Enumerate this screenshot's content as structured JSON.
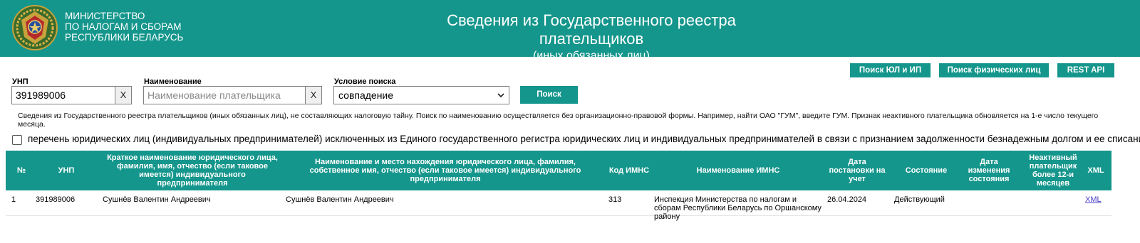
{
  "header": {
    "ministry_line1": "МИНИСТЕРСТВО",
    "ministry_line2": "ПО НАЛОГАМ И СБОРАМ",
    "ministry_line3": "РЕСПУБЛИКИ БЕЛАРУСЬ",
    "title": "Сведения из Государственного реестра плательщиков",
    "subtitle": "(иных обязанных лиц)"
  },
  "nav_buttons": {
    "search_legal": "Поиск ЮЛ и ИП",
    "search_individuals": "Поиск физических лиц",
    "rest_api": "REST API"
  },
  "search": {
    "unp_label": "УНП",
    "unp_value": "391989006",
    "name_label": "Наименование",
    "name_placeholder": "Наименование плательщика",
    "condition_label": "Условие поиска",
    "condition_value": "совпадение",
    "clear_label": "X",
    "search_button": "Поиск"
  },
  "info_text": "Сведения из Государственного реестра плательщиков (иных обязанных лиц), не составляющих налоговую тайну. Поиск по наименованию осуществляется без организационно-правовой формы. Например, найти ОАО \"ГУМ\", введите ГУМ. Признак неактивного плательщика обновляется на 1-е число текущего месяца.",
  "excluded_checkbox": {
    "checked": false,
    "label": "перечень юридических лиц (индивидуальных предпринимателей) исключенных из Единого государственного регистра юридических лиц и индивидуальных предпринимателей в связи с признанием задолженности безнадежным долгом и ее списании"
  },
  "table": {
    "headers": {
      "num": "№",
      "unp": "УНП",
      "short_name": "Краткое наименование юридического лица, фамилия, имя, отчество (если таковое имеется) индивидуального предпринимателя",
      "full_name": "Наименование и место нахождения юридического лица, фамилия, собственное имя, отчество (если таковое имеется) индивидуального предпринимателя",
      "imns_code": "Код ИМНС",
      "imns_name": "Наименование ИМНС",
      "reg_date": "Дата постановки на учет",
      "status": "Состояние",
      "status_date": "Дата изменения состояния",
      "inactive": "Неактивный плательщик более 12-и месяцев",
      "xml": "XML"
    },
    "rows": [
      {
        "num": "1",
        "unp": "391989006",
        "short_name": "Сушнёв Валентин Андреевич",
        "full_name": "Сушнёв Валентин Андреевич",
        "imns_code": "313",
        "imns_name": "Инспекция Министерства по налогам и сборам Республики Беларусь по Оршанскому району",
        "reg_date": "26.04.2024",
        "status": "Действующий",
        "status_date": "",
        "inactive": "",
        "xml": "XML"
      }
    ]
  },
  "colors": {
    "accent": "#15968c",
    "link": "#4b3fc9"
  },
  "icons": {
    "emblem": "ministry-emblem-icon",
    "select_chevron": "chevron-down-icon"
  }
}
